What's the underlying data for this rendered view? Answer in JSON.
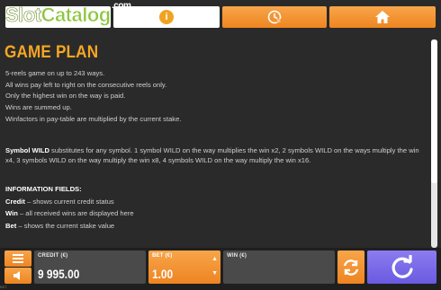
{
  "watermark": {
    "slot": "Slot",
    "catalog": "Catalog",
    "com": ".com"
  },
  "tabs": [
    {
      "name": "info",
      "icon": "info-icon",
      "glyph": "i"
    },
    {
      "name": "history",
      "icon": "history-icon"
    },
    {
      "name": "home",
      "icon": "home-icon"
    }
  ],
  "content": {
    "title": "GAME PLAN",
    "rules": [
      "5-reels game on up to 243 ways.",
      "All wins pay left to right on the consecutive reels only.",
      "Only the highest win on the way is paid.",
      "Wins are summed up.",
      "Winfactors in pay-table are multiplied by the current stake."
    ],
    "wild_label": "Symbol WILD",
    "wild_text": " substitutes for any symbol. 1 symbol WILD on the way multiplies the win x2, 2 symbols WILD on the ways multiply the win x4, 3 symbols WILD on the way multiply the win x8, 4 symbols WILD on the way multiply the win x16.",
    "fields_heading": "INFORMATION FIELDS:",
    "fields": [
      {
        "label": "Credit",
        "text": " – shows current credit status"
      },
      {
        "label": "Win",
        "text": " – all received wins are displayed here"
      },
      {
        "label": "Bet",
        "text": " – shows the current stake value"
      }
    ]
  },
  "bottom": {
    "credit_label": "CREDIT (€)",
    "credit_value": "9 995.00",
    "bet_label": "BET (€)",
    "bet_value": "1.00",
    "win_label": "WIN (€)",
    "win_value": "",
    "bet_tag": "BET"
  },
  "colors": {
    "accent": "#f5a623",
    "spin": "#6a5ae0",
    "background": "#2a2a2a"
  }
}
